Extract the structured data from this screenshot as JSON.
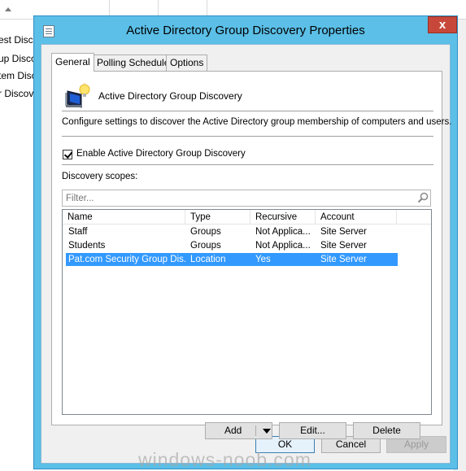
{
  "background": {
    "rows": [
      "est Disco",
      "up Disco",
      "tem Disco",
      "r Discov"
    ]
  },
  "dialog": {
    "title": "Active Directory Group Discovery Properties",
    "close_label": "x",
    "tabs": [
      {
        "label": "General",
        "active": true
      },
      {
        "label": "Polling Schedule",
        "active": false
      },
      {
        "label": "Options",
        "active": false
      }
    ],
    "general": {
      "heading": "Active Directory Group Discovery",
      "description": "Configure settings to discover the Active Directory group membership of computers and users.",
      "enable_label": "Enable Active Directory Group Discovery",
      "enable_checked": true,
      "scopes_label": "Discovery scopes:",
      "filter_placeholder": "Filter...",
      "columns": [
        "Name",
        "Type",
        "Recursive",
        "Account"
      ],
      "rows": [
        {
          "name": "Staff",
          "type": "Groups",
          "recursive": "Not Applica...",
          "account": "Site Server",
          "selected": false
        },
        {
          "name": "Students",
          "type": "Groups",
          "recursive": "Not Applica...",
          "account": "Site Server",
          "selected": false
        },
        {
          "name": "Pat.com Security Group Dis...",
          "type": "Location",
          "recursive": "Yes",
          "account": "Site Server",
          "selected": true
        }
      ],
      "add_label": "Add",
      "edit_label": "Edit...",
      "delete_label": "Delete"
    },
    "footer": {
      "ok_label": "OK",
      "cancel_label": "Cancel",
      "apply_label": "Apply"
    }
  },
  "watermark": "windows-noob.com",
  "colors": {
    "title_bar": "#5bbfe7",
    "close_button": "#c7483a",
    "selection": "#3399ff"
  }
}
